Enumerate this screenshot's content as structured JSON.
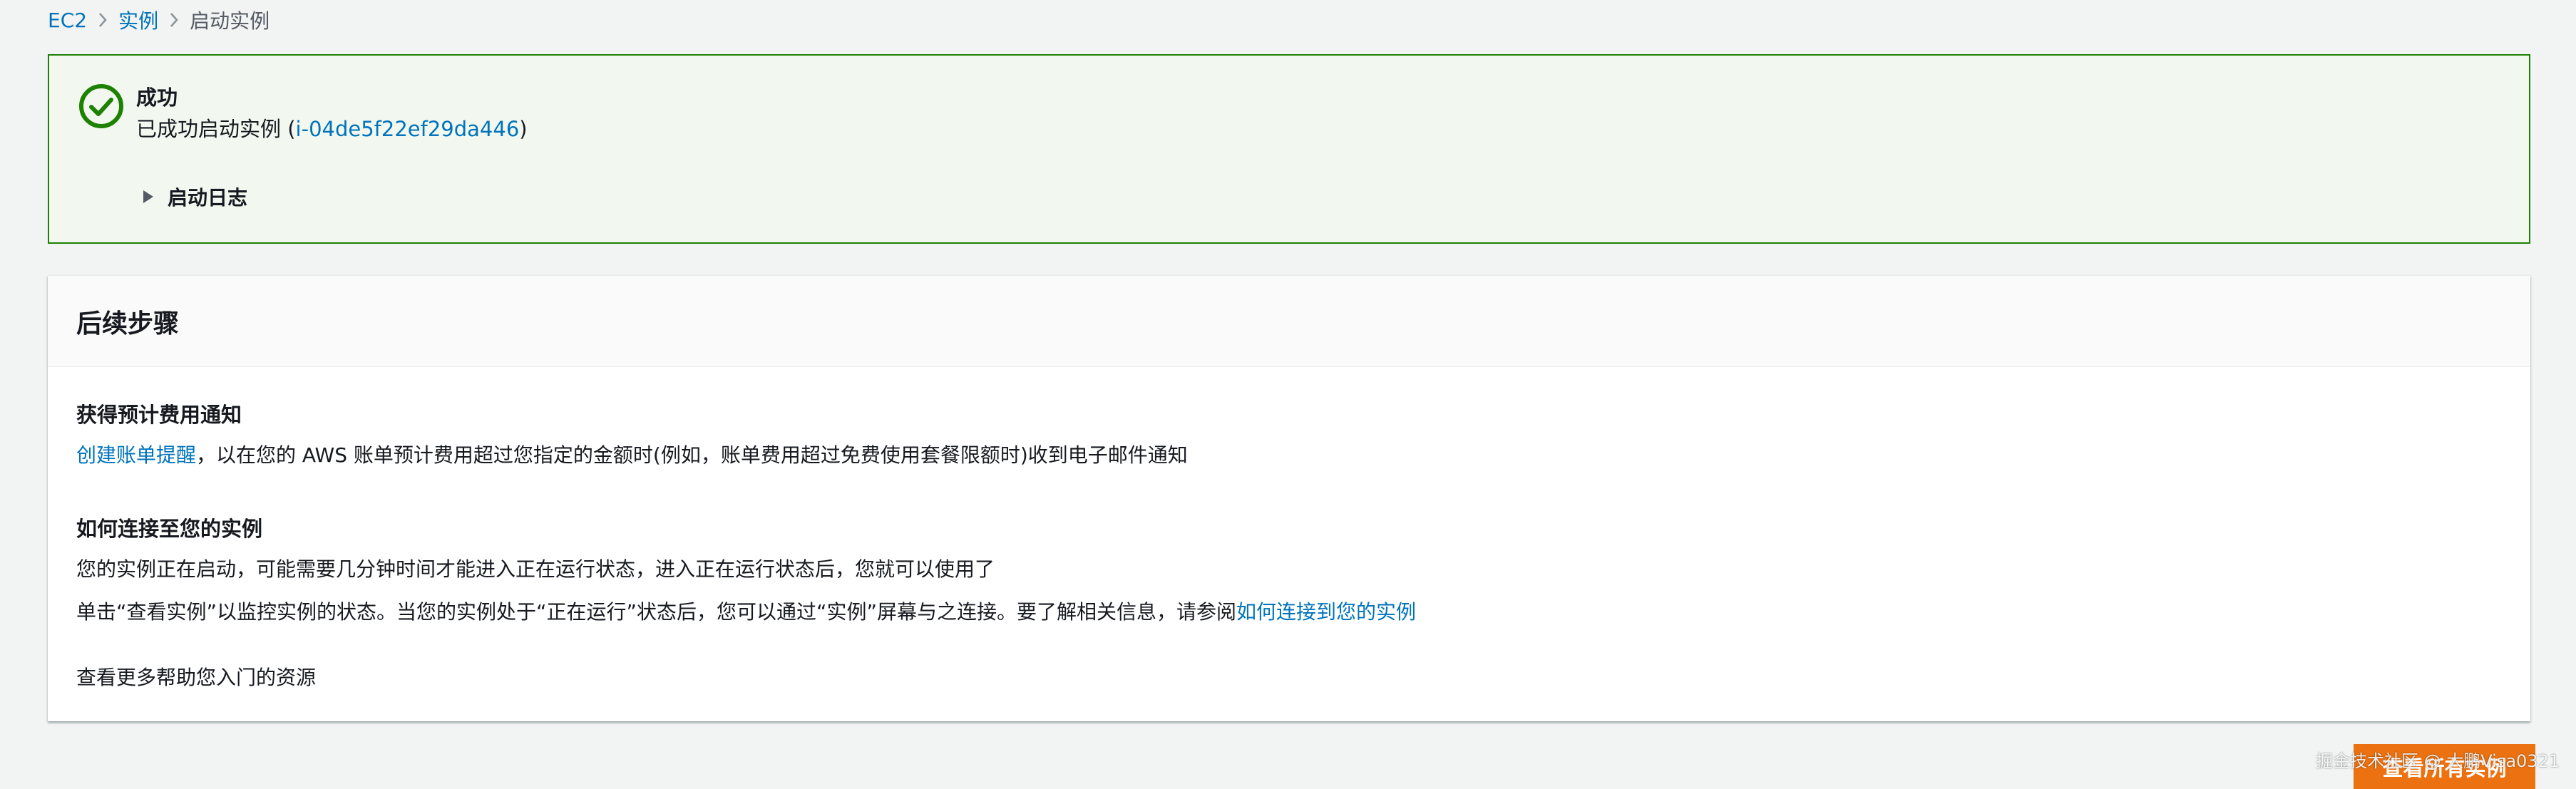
{
  "breadcrumb": {
    "items": [
      "EC2",
      "实例"
    ],
    "current": "启动实例"
  },
  "flash": {
    "title": "成功",
    "message_prefix": "已成功启动实例 (",
    "instance_id": "i-04de5f22ef29da446",
    "message_suffix": ")",
    "log_label": "启动日志",
    "colors": {
      "border": "#1d8102",
      "background": "#f2f8f0"
    }
  },
  "next_steps": {
    "title": "后续步骤",
    "billing": {
      "title": "获得预计费用通知",
      "link": "创建账单提醒",
      "text": "，以在您的 AWS 账单预计费用超过您指定的金额时(例如，账单费用超过免费使用套餐限额时)收到电子邮件通知"
    },
    "connect": {
      "title": "如何连接至您的实例",
      "line1": "您的实例正在启动，可能需要几分钟时间才能进入正在运行状态，进入正在运行状态后，您就可以使用了",
      "line2_text": "单击“查看实例”以监控实例的状态。当您的实例处于“正在运行”状态后，您可以通过“实例”屏幕与之连接。要了解相关信息，请参阅",
      "line2_link": "如何连接到您的实例"
    },
    "resources_link": "查看更多帮助您入门的资源"
  },
  "footer": {
    "view_all_button": "查看所有实例",
    "watermark": "掘金技术社区 @ 大鹏Visa0321",
    "accent_color": "#ec7211"
  },
  "icons": {
    "success": "check-circle-icon",
    "separator": "chevron-right-icon",
    "expand": "caret-right-icon"
  }
}
